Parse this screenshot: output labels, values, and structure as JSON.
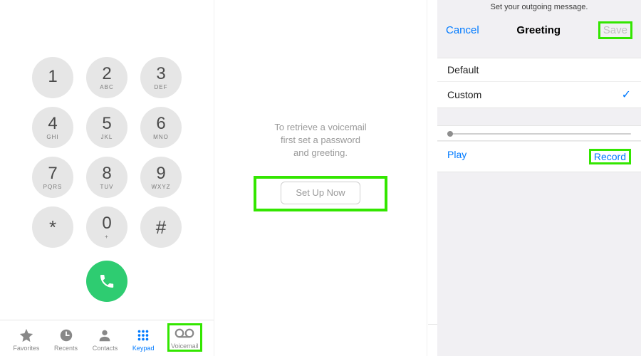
{
  "keypad": {
    "keys": [
      {
        "digit": "1",
        "letters": ""
      },
      {
        "digit": "2",
        "letters": "ABC"
      },
      {
        "digit": "3",
        "letters": "DEF"
      },
      {
        "digit": "4",
        "letters": "GHI"
      },
      {
        "digit": "5",
        "letters": "JKL"
      },
      {
        "digit": "6",
        "letters": "MNO"
      },
      {
        "digit": "7",
        "letters": "PQRS"
      },
      {
        "digit": "8",
        "letters": "TUV"
      },
      {
        "digit": "9",
        "letters": "WXYZ"
      },
      {
        "digit": "*",
        "letters": ""
      },
      {
        "digit": "0",
        "letters": "+"
      },
      {
        "digit": "#",
        "letters": ""
      }
    ]
  },
  "tabs": {
    "favorites": "Favorites",
    "recents": "Recents",
    "contacts": "Contacts",
    "keypad": "Keypad",
    "voicemail": "Voicemail"
  },
  "setup": {
    "line1": "To retrieve a voicemail",
    "line2": "first set a password",
    "line3": "and greeting.",
    "button": "Set Up Now"
  },
  "greeting": {
    "subheader": "Set your outgoing message.",
    "cancel": "Cancel",
    "title": "Greeting",
    "save": "Save",
    "options": {
      "default": "Default",
      "custom": "Custom"
    },
    "selected": "custom",
    "play": "Play",
    "record": "Record"
  },
  "colors": {
    "accent": "#007aff",
    "highlight": "#33e600",
    "call": "#2ecc71"
  }
}
